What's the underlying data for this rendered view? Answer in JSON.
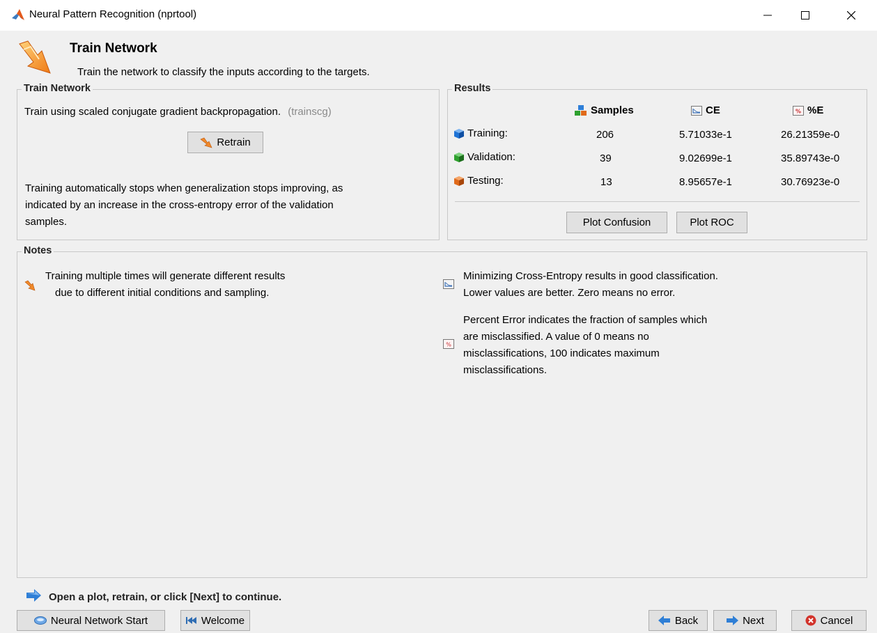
{
  "window": {
    "title": "Neural Pattern Recognition (nprtool)",
    "icon": "matlab-icon"
  },
  "header": {
    "title": "Train Network",
    "subtitle": "Train the network to classify the inputs according to the targets."
  },
  "train_panel": {
    "label": "Train Network",
    "description": "Train using scaled conjugate gradient backpropagation.",
    "algorithm": "(trainscg)",
    "retrain_label": "Retrain",
    "stop_note_line1": "Training automatically stops when generalization stops improving, as",
    "stop_note_line2": "indicated by an increase in the cross-entropy error of the validation",
    "stop_note_line3": "samples."
  },
  "results_panel": {
    "label": "Results",
    "columns": {
      "samples": "Samples",
      "ce": "CE",
      "pe": "%E"
    },
    "rows": [
      {
        "label": "Training:",
        "samples": "206",
        "ce": "5.71033e-1",
        "pe": "26.21359e-0",
        "color": "#1e73d6"
      },
      {
        "label": "Validation:",
        "samples": "39",
        "ce": "9.02699e-1",
        "pe": "35.89743e-0",
        "color": "#2ea02e"
      },
      {
        "label": "Testing:",
        "samples": "13",
        "ce": "8.95657e-1",
        "pe": "30.76923e-0",
        "color": "#e06a1a"
      }
    ],
    "plot_confusion_label": "Plot Confusion",
    "plot_roc_label": "Plot ROC"
  },
  "notes_panel": {
    "label": "Notes",
    "note1_line1": "Training multiple times will generate different results",
    "note1_line2": "due to different initial conditions and sampling.",
    "note2_line1": "Minimizing Cross-Entropy results in good classification.",
    "note2_line2": "Lower values are better. Zero means no error.",
    "note3_line1": "Percent Error  indicates the fraction of samples which",
    "note3_line2": "are misclassified. A value of 0 means no",
    "note3_line3": "misclassifications, 100 indicates maximum",
    "note3_line4": "misclassifications."
  },
  "status": {
    "text": "Open a plot, retrain, or click [Next] to continue."
  },
  "footer": {
    "nn_start_label": "Neural Network Start",
    "welcome_label": "Welcome",
    "back_label": "Back",
    "next_label": "Next",
    "cancel_label": "Cancel"
  },
  "colors": {
    "accent_orange": "#f0892a",
    "arrow_blue": "#2f7fd6",
    "cancel_red": "#d2332b",
    "panel_border": "#c8c8c8"
  }
}
